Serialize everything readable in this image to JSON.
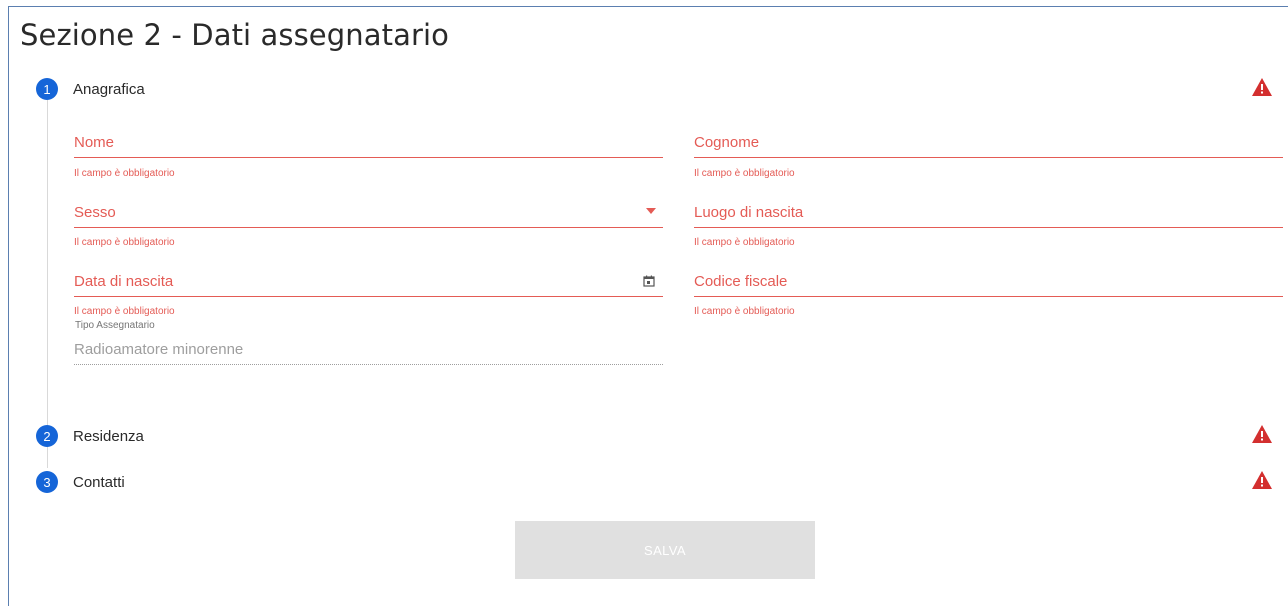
{
  "page": {
    "title": "Sezione 2 - Dati assegnatario"
  },
  "steps": [
    {
      "number": "1",
      "label": "Anagrafica",
      "status_icon": "warning-icon"
    },
    {
      "number": "2",
      "label": "Residenza",
      "status_icon": "warning-icon"
    },
    {
      "number": "3",
      "label": "Contatti",
      "status_icon": "warning-icon"
    }
  ],
  "form": {
    "nome": {
      "label": "Nome",
      "error": "Il campo è obbligatorio"
    },
    "cognome": {
      "label": "Cognome",
      "error": "Il campo è obbligatorio"
    },
    "sesso": {
      "label": "Sesso",
      "error": "Il campo è obbligatorio",
      "icon": "dropdown-arrow-icon"
    },
    "luogo_nascita": {
      "label": "Luogo di nascita",
      "error": "Il campo è obbligatorio"
    },
    "data_nascita": {
      "label": "Data di nascita",
      "error": "Il campo è obbligatorio",
      "icon": "calendar-icon"
    },
    "codice_fiscale": {
      "label": "Codice fiscale",
      "error": "Il campo è obbligatorio"
    },
    "tipo_assegnatario": {
      "label": "Tipo Assegnatario",
      "value": "Radioamatore minorenne"
    }
  },
  "actions": {
    "save_label": "SALVA"
  },
  "colors": {
    "error": "#e45b55",
    "step_accent": "#1565d8",
    "warning": "#d32f2f",
    "button_disabled": "#e0e0e0"
  }
}
